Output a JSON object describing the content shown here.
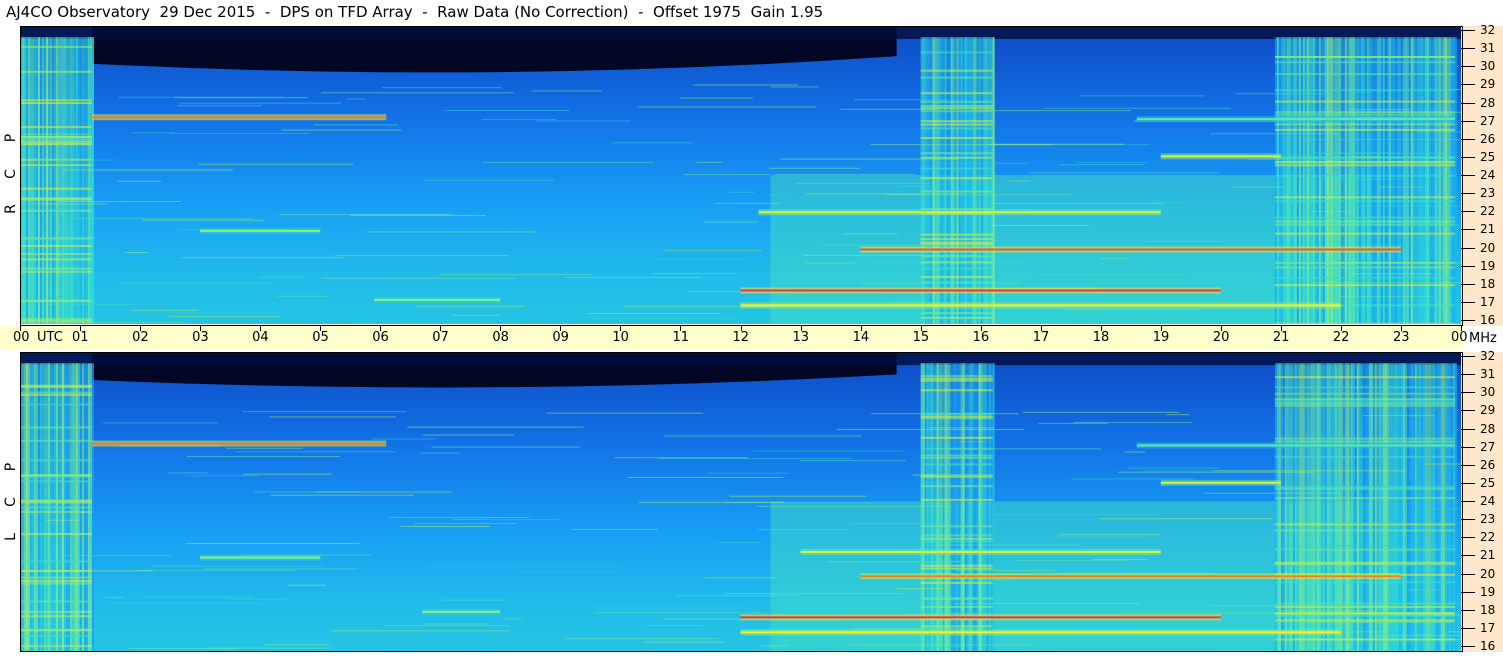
{
  "chart_data": {
    "type": "heatmap",
    "title": "AJ4CO Observatory  29 Dec 2015  -  DPS on TFD Array  -  Raw Data (No Correction)  -  Offset 1975  Gain 1.95",
    "xlabel": "UTC",
    "x_unit_label": "MHz",
    "x_ticks": [
      "00",
      "01",
      "02",
      "03",
      "04",
      "05",
      "06",
      "07",
      "08",
      "09",
      "10",
      "11",
      "12",
      "13",
      "14",
      "15",
      "16",
      "17",
      "18",
      "19",
      "20",
      "21",
      "22",
      "23",
      "00"
    ],
    "xlim": [
      0,
      24
    ],
    "y_ticks": [
      16,
      17,
      18,
      19,
      20,
      21,
      22,
      23,
      24,
      25,
      26,
      27,
      28,
      29,
      30,
      31,
      32
    ],
    "ylim": [
      16,
      32
    ],
    "grid": false,
    "colormap": [
      "#000010",
      "#0a2a9a",
      "#1060e0",
      "#18a8f8",
      "#30e0d0",
      "#b0f060",
      "#f8f020",
      "#f06030",
      "#e01070"
    ],
    "panels": [
      {
        "name": "RCP",
        "pol_letters": [
          "R",
          "C",
          "P"
        ],
        "features": [
          {
            "kind": "dark_band",
            "t_start": 1.2,
            "t_end": 14.6,
            "f_low": 29.3,
            "f_high": 32
          },
          {
            "kind": "broadband_rfi",
            "t_start": 0.0,
            "t_end": 1.2
          },
          {
            "kind": "broadband_rfi",
            "t_start": 15.0,
            "t_end": 16.2
          },
          {
            "kind": "broadband_rfi",
            "t_start": 20.9,
            "t_end": 23.9
          },
          {
            "kind": "narrowband",
            "freq": 27.1,
            "t_start": 1.2,
            "t_end": 6.1,
            "level": 0.85
          },
          {
            "kind": "narrowband",
            "freq": 21.0,
            "t_start": 3.0,
            "t_end": 5.0,
            "level": 0.6
          },
          {
            "kind": "narrowband",
            "freq": 17.8,
            "t_start": 12.0,
            "t_end": 20.0,
            "level": 0.95
          },
          {
            "kind": "narrowband",
            "freq": 17.3,
            "t_start": 5.9,
            "t_end": 8.0,
            "level": 0.6
          },
          {
            "kind": "narrowband",
            "freq": 20.0,
            "t_start": 14.0,
            "t_end": 23.0,
            "level": 0.9
          },
          {
            "kind": "narrowband",
            "freq": 22.0,
            "t_start": 12.3,
            "t_end": 19.0,
            "level": 0.7
          },
          {
            "kind": "narrowband",
            "freq": 25.0,
            "t_start": 19.0,
            "t_end": 21.0,
            "level": 0.7
          },
          {
            "kind": "narrowband",
            "freq": 27.0,
            "t_start": 18.6,
            "t_end": 23.9,
            "level": 0.55
          },
          {
            "kind": "narrowband",
            "freq": 17.0,
            "t_start": 12.0,
            "t_end": 22.0,
            "level": 0.75
          }
        ]
      },
      {
        "name": "LCP",
        "pol_letters": [
          "L",
          "C",
          "P"
        ],
        "features": [
          {
            "kind": "dark_band",
            "t_start": 1.2,
            "t_end": 14.6,
            "f_low": 30.0,
            "f_high": 32
          },
          {
            "kind": "broadband_rfi",
            "t_start": 0.0,
            "t_end": 1.2
          },
          {
            "kind": "broadband_rfi",
            "t_start": 15.0,
            "t_end": 16.2
          },
          {
            "kind": "broadband_rfi",
            "t_start": 20.9,
            "t_end": 23.9
          },
          {
            "kind": "narrowband",
            "freq": 27.1,
            "t_start": 1.2,
            "t_end": 6.1,
            "level": 0.85
          },
          {
            "kind": "narrowband",
            "freq": 21.0,
            "t_start": 3.0,
            "t_end": 5.0,
            "level": 0.6
          },
          {
            "kind": "narrowband",
            "freq": 17.8,
            "t_start": 12.0,
            "t_end": 20.0,
            "level": 0.95
          },
          {
            "kind": "narrowband",
            "freq": 18.1,
            "t_start": 6.7,
            "t_end": 8.0,
            "level": 0.6
          },
          {
            "kind": "narrowband",
            "freq": 20.0,
            "t_start": 14.0,
            "t_end": 23.0,
            "level": 0.85
          },
          {
            "kind": "narrowband",
            "freq": 21.3,
            "t_start": 13.0,
            "t_end": 19.0,
            "level": 0.7
          },
          {
            "kind": "narrowband",
            "freq": 25.0,
            "t_start": 19.0,
            "t_end": 21.0,
            "level": 0.7
          },
          {
            "kind": "narrowband",
            "freq": 27.0,
            "t_start": 18.6,
            "t_end": 23.9,
            "level": 0.55
          },
          {
            "kind": "narrowband",
            "freq": 17.0,
            "t_start": 12.0,
            "t_end": 22.0,
            "level": 0.75
          }
        ]
      }
    ]
  }
}
